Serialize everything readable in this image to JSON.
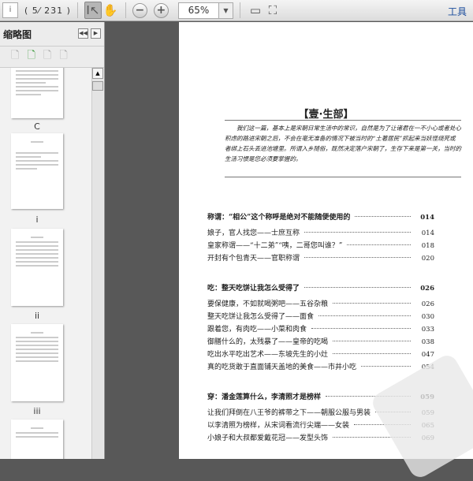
{
  "toolbar": {
    "page_input": "i",
    "page_count": "( 5⁄ 231 )",
    "zoom_value": "65%",
    "tools_label": "工具"
  },
  "sidebar": {
    "title": "缩略图",
    "thumbnails": [
      {
        "label": "C"
      },
      {
        "label": "i"
      },
      {
        "label": "ii"
      },
      {
        "label": "iii"
      }
    ]
  },
  "document": {
    "section_title": "【壹·生部】",
    "intro": "我们这一篇，基本上是宋朝日常生活中的常识，自然是为了让诸君在一不小心或者处心积虑的路进宋朝之后，不会在毫无准备的情况下被当时的“土著居民”抓起来当妖怪烧死或者绑上石头丢进池塘里。所谓入乡随俗，既然决定落户宋朝了，生存下来是第一关，当时的生活习惯是您必须要掌握的。",
    "toc": [
      {
        "title": "称谓：“相公”这个称呼是绝对不能随便使用的",
        "page": "014",
        "heading": true
      },
      {
        "title": "娘子，官人找您——士庶互称",
        "page": "014"
      },
      {
        "title": "皇家称谓——“十二弟”“咦，二哥您叫谁？”",
        "page": "018"
      },
      {
        "title": "开封有个包青天——官职称谓",
        "page": "020"
      },
      {
        "title": "吃：整天吃饼让我怎么受得了",
        "page": "026",
        "heading": true
      },
      {
        "title": "要保健康，不如就喝粥吧——五谷杂粮",
        "page": "026"
      },
      {
        "title": "整天吃饼让我怎么受得了——面食",
        "page": "030"
      },
      {
        "title": "跟着您，有肉吃——小菜和肉食",
        "page": "033"
      },
      {
        "title": "御膳什么的，太残暴了——皇帝的吃喝",
        "page": "038"
      },
      {
        "title": "吃出水平吃出艺术——东坡先生的小灶",
        "page": "047"
      },
      {
        "title": "真的吃货敢于直面铺天盖地的美食——市井小吃",
        "page": "054"
      },
      {
        "title": "穿：潘金莲算什么，李清照才是榜样",
        "page": "059",
        "heading": true
      },
      {
        "title": "让我们拜倒在八王爷的裤带之下——朝服公服与男装",
        "page": "059"
      },
      {
        "title": "以李清照为榜样，从宋词看流行尖端——女装",
        "page": "065"
      },
      {
        "title": "小娘子和大叔都爱戴花冠——发型头饰",
        "page": "069"
      }
    ]
  }
}
